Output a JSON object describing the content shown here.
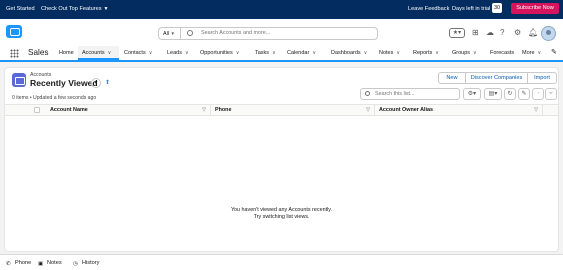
{
  "topbar": {
    "get_started": "Get Started",
    "check_out": "Check Out Top Features",
    "leave_feedback": "Leave Feedback",
    "days_left_label": "Days left in trial",
    "days_left_value": "30",
    "subscribe": "Subscribe Now"
  },
  "header": {
    "search_scope": "All",
    "search_placeholder": "Search Accounts and more...",
    "favorite_glyph": "★▾"
  },
  "nav": {
    "app_name": "Sales",
    "items": [
      {
        "label": "Home",
        "dropdown": false
      },
      {
        "label": "Accounts",
        "dropdown": true
      },
      {
        "label": "Contacts",
        "dropdown": true
      },
      {
        "label": "Leads",
        "dropdown": true
      },
      {
        "label": "Opportunities",
        "dropdown": true
      },
      {
        "label": "Tasks",
        "dropdown": true
      },
      {
        "label": "Calendar",
        "dropdown": true
      },
      {
        "label": "Dashboards",
        "dropdown": true
      },
      {
        "label": "Notes",
        "dropdown": true
      },
      {
        "label": "Reports",
        "dropdown": true
      },
      {
        "label": "Groups",
        "dropdown": true
      },
      {
        "label": "Forecasts",
        "dropdown": false
      },
      {
        "label": "More",
        "dropdown": true
      }
    ],
    "active_index": 1
  },
  "list": {
    "object_label": "Accounts",
    "view_name": "Recently Viewed",
    "buttons": {
      "new": "New",
      "discover": "Discover Companies",
      "import": "Import"
    },
    "meta": "0 items • Updated a few seconds ago",
    "search_placeholder": "Search this list...",
    "columns": [
      "Account Name",
      "Phone",
      "Account Owner Alias"
    ],
    "empty_line1": "You haven't viewed any Accounts recently.",
    "empty_line2": "Try switching list views."
  },
  "footer": {
    "phone": "Phone",
    "notes": "Notes",
    "history": "History"
  },
  "colors": {
    "topbar": "#032d60",
    "brand": "#1b96ff",
    "subscribe": "#d6145e",
    "object_icon": "#5a68d8"
  }
}
